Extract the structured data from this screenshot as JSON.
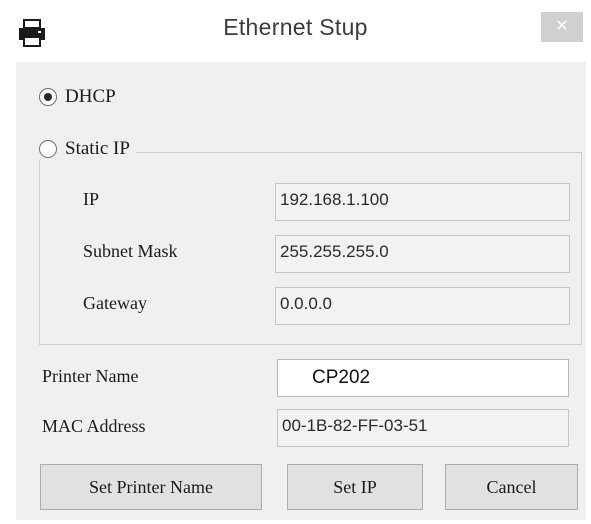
{
  "window": {
    "title": "Ethernet Stup",
    "close_glyph": "✕",
    "icon": "printer-icon"
  },
  "network_mode": {
    "dhcp_label": "DHCP",
    "static_label": "Static IP",
    "selected": "DHCP"
  },
  "static_ip": {
    "ip_label": "IP",
    "ip_value": "192.168.1.100",
    "subnet_label": "Subnet Mask",
    "subnet_value": "255.255.255.0",
    "gateway_label": "Gateway",
    "gateway_value": "0.0.0.0"
  },
  "printer": {
    "name_label": "Printer Name",
    "name_value": "CP202",
    "mac_label": "MAC Address",
    "mac_value": "00-1B-82-FF-03-51"
  },
  "buttons": {
    "set_name": "Set Printer Name",
    "set_ip": "Set IP",
    "cancel": "Cancel"
  }
}
